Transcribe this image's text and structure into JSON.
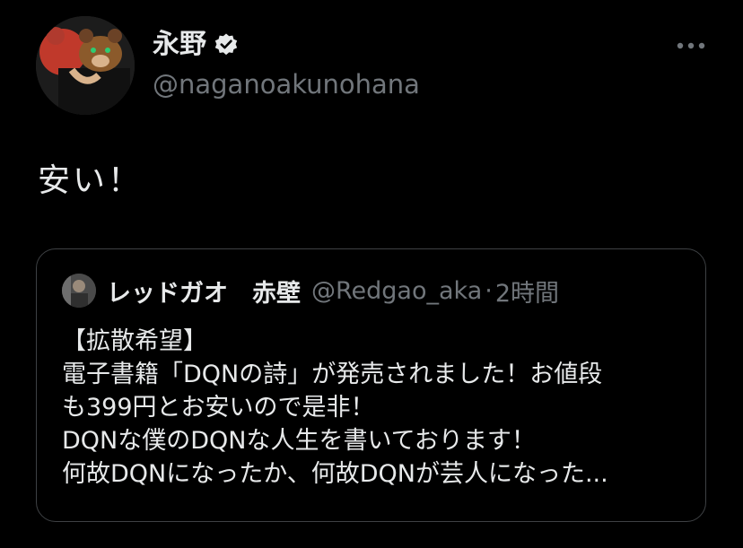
{
  "author": {
    "display_name": "永野",
    "handle": "@naganoakunohana",
    "verified": true
  },
  "tweet": {
    "text": "安い！"
  },
  "icons": {
    "avatar": "avatar-bear-mask",
    "verified": "verified-badge-icon",
    "more": "more-dots-icon"
  },
  "quote": {
    "author_name": "レッドガオ　赤壁",
    "handle": "@Redgao_aka",
    "separator": "·",
    "time": "2時間",
    "lines": [
      "【拡散希望】",
      "電子書籍「DQNの詩」が発売されました！お値段",
      "も399円とお安いので是非！",
      "DQNな僕のDQNな人生を書いております！",
      "何故DQNになったか、何故DQNが芸人になった..."
    ]
  },
  "colors": {
    "background": "#000000",
    "text_primary": "#e7e9ea",
    "text_secondary": "#71767b",
    "border": "#3e4144"
  }
}
